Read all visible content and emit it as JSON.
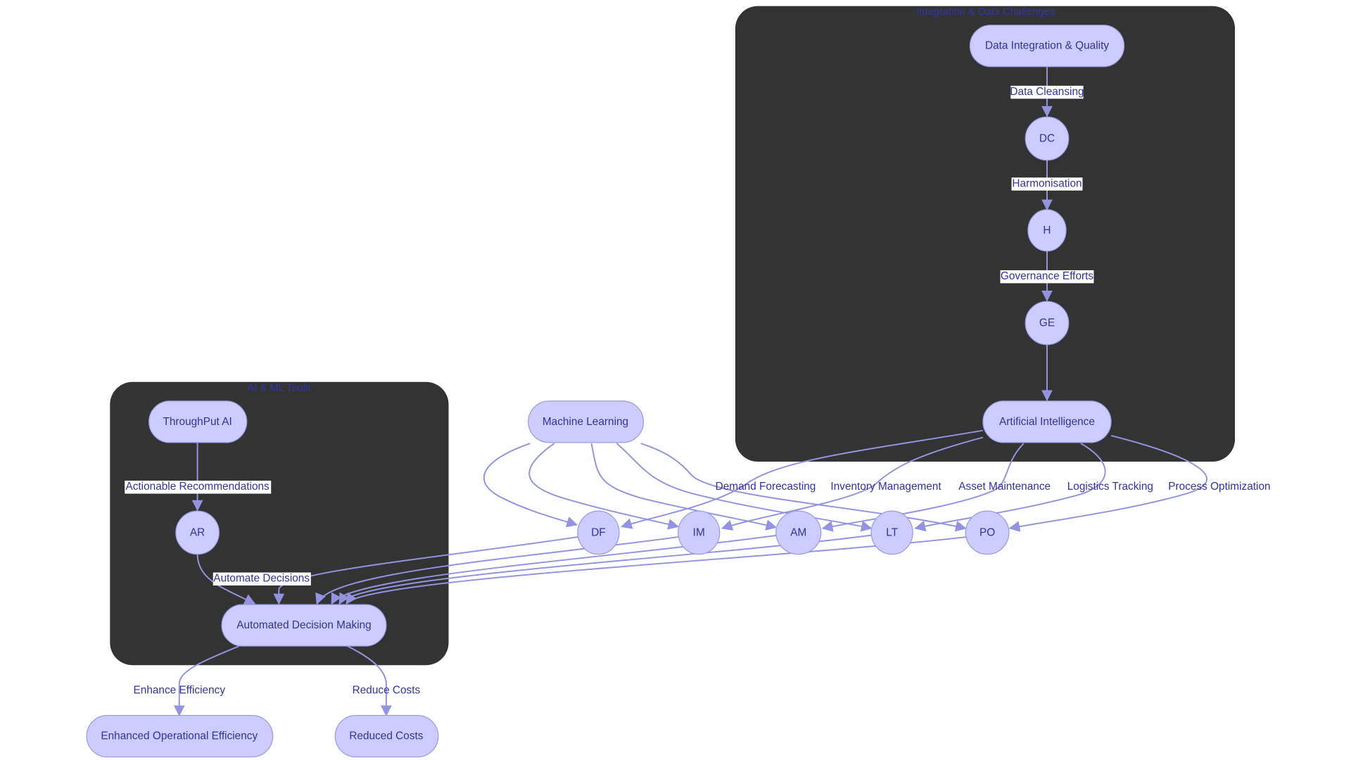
{
  "clusters": {
    "integration": "Integration & Data Challenges",
    "aiml": "AI & ML Tools"
  },
  "nodes": {
    "diq": "Data Integration & Quality",
    "dc": "DC",
    "h": "H",
    "ge": "GE",
    "ai": "Artificial Intelligence",
    "ml": "Machine Learning",
    "tp": "ThroughPut AI",
    "ar": "AR",
    "adm": "Automated Decision Making",
    "df": "DF",
    "im": "IM",
    "am": "AM",
    "lt": "LT",
    "po": "PO",
    "eoe": "Enhanced Operational Efficiency",
    "rc": "Reduced Costs"
  },
  "edge_labels": {
    "data_cleansing": "Data Cleansing",
    "harmonisation": "Harmonisation",
    "governance": "Governance Efforts",
    "actionable": "Actionable Recommendations",
    "automate": "Automate Decisions",
    "demand": "Demand Forecasting",
    "inventory": "Inventory Management",
    "asset": "Asset Maintenance",
    "logistics": "Logistics Tracking",
    "process": "Process Optimization",
    "enhance": "Enhance Efficiency",
    "reduce": "Reduce Costs"
  },
  "colors": {
    "node_fill": "#ccccff",
    "node_stroke": "#9a9ae6",
    "edge": "#9393e0",
    "cluster": "#333333",
    "text": "#333399"
  }
}
